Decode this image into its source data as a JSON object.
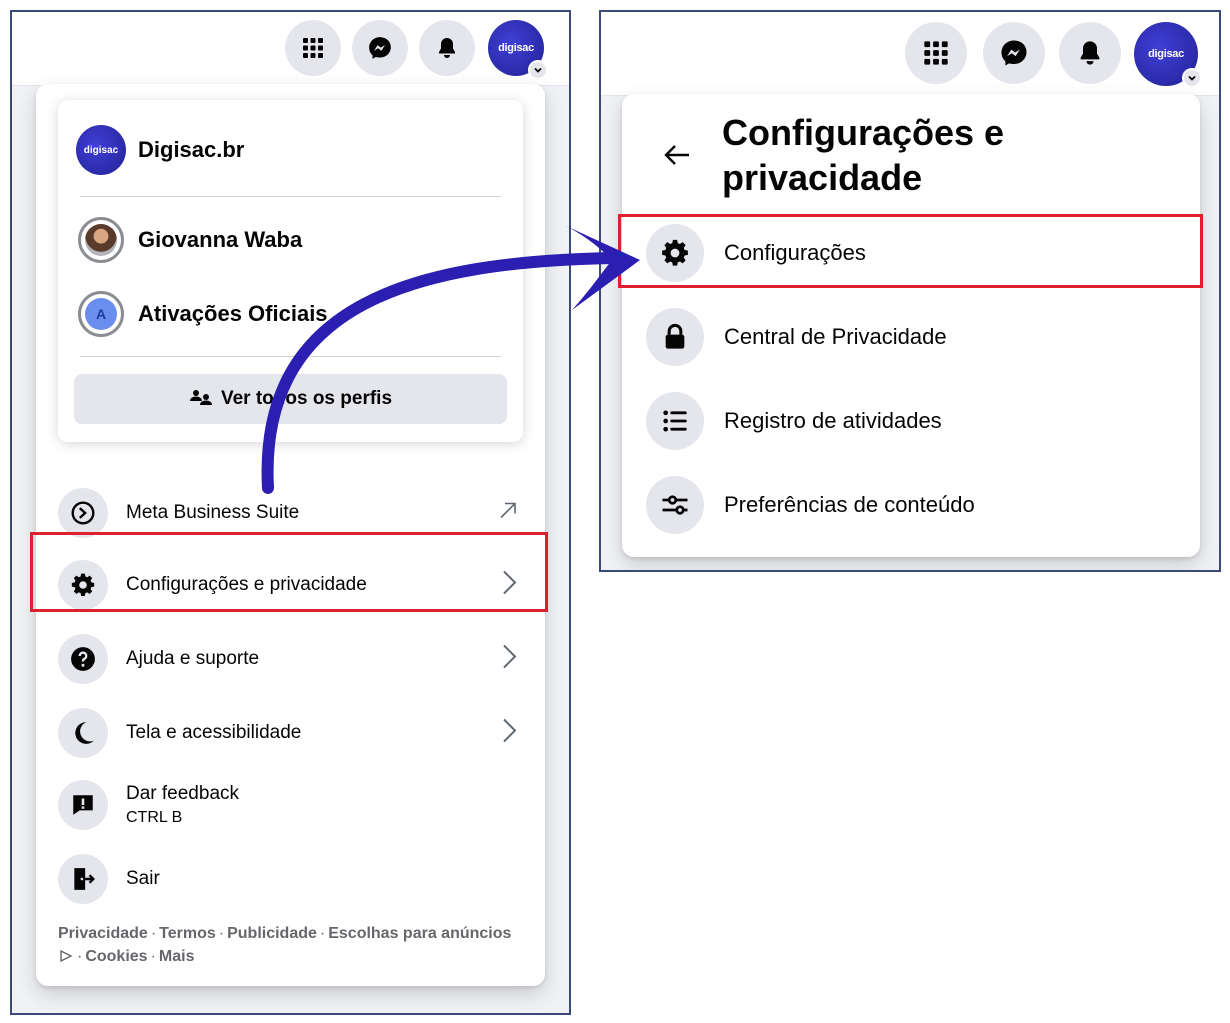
{
  "left_panel": {
    "avatar_logo": "digisac",
    "profiles": [
      {
        "name": "Digisac.br",
        "avatar": "digisac-logo"
      },
      {
        "name": "Giovanna Waba",
        "avatar": "person-photo"
      },
      {
        "name": "Ativações Oficiais",
        "avatar": "letter-avatar",
        "initial": "A"
      }
    ],
    "see_all_label": "Ver todos os perfis",
    "menu": [
      {
        "label": "Meta Business Suite",
        "icon": "meta-business-icon",
        "right": "external-arrow-icon"
      },
      {
        "label": "Configurações e privacidade",
        "icon": "gear-icon",
        "right": "chevron-right-icon"
      },
      {
        "label": "Ajuda e suporte",
        "icon": "question-icon",
        "right": "chevron-right-icon"
      },
      {
        "label": "Tela e acessibilidade",
        "icon": "moon-icon",
        "right": "chevron-right-icon"
      },
      {
        "label": "Dar feedback",
        "sub": "CTRL B",
        "icon": "feedback-icon"
      },
      {
        "label": "Sair",
        "icon": "logout-icon"
      }
    ],
    "footer": {
      "links": [
        "Privacidade",
        "Termos",
        "Publicidade",
        "Escolhas para anúncios",
        "Cookies",
        "Mais"
      ],
      "separator": "·"
    }
  },
  "right_panel": {
    "title": "Configurações e privacidade",
    "items": [
      {
        "label": "Configurações",
        "icon": "gear-icon"
      },
      {
        "label": "Central de Privacidade",
        "icon": "lock-icon"
      },
      {
        "label": "Registro de atividades",
        "icon": "list-icon"
      },
      {
        "label": "Preferências de conteúdo",
        "icon": "sliders-icon"
      }
    ]
  },
  "colors": {
    "highlight": "#e0202e",
    "arrow": "#2a1fb0",
    "avatar_bg": "#2a2aa8",
    "icon_bg": "#e4e6eb"
  }
}
